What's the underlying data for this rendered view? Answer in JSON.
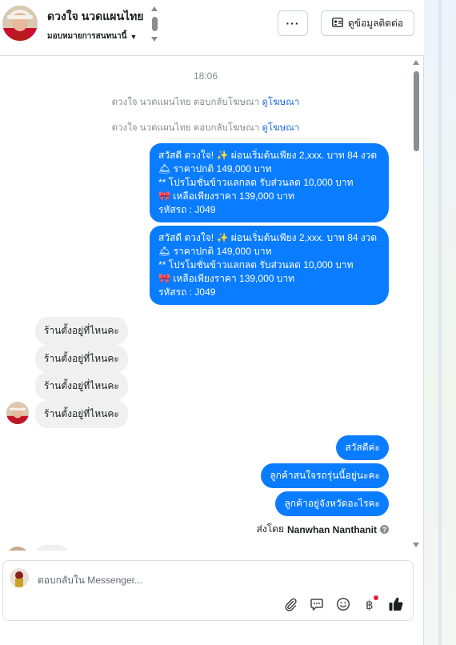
{
  "header": {
    "contact_name": "ดวงใจ นวดแผนไทย",
    "assign_label": "มอบหมายการสนทนานี้",
    "more_label": "···",
    "contact_info_label": "ดูข้อมูลติดต่อ"
  },
  "thread": {
    "time": "18:06",
    "system_messages": [
      {
        "text": "ดวงใจ นวดแผนไทย ตอบกลับโฆษณา",
        "link": "ดูโฆษณา"
      },
      {
        "text": "ดวงใจ นวดแผนไทย ตอบกลับโฆษณา",
        "link": "ดูโฆษณา"
      }
    ],
    "promo_messages": [
      [
        "สวัสดี ดวงใจ! ✨  ผ่อนเริ่มต้นเพียง 2,xxx. บาท 84 งวด",
        "🛎 ราคาปกติ 149,000 บาท",
        "** โปรโมชั่นข้าวแลกลด รับส่วนลด 10,000 บาท",
        "🎀  เหลือเพียงราคา 139,000 บาท",
        " รหัสรถ : J049"
      ],
      [
        "สวัสดี ดวงใจ! ✨  ผ่อนเริ่มต้นเพียง 2,xxx. บาท 84 งวด",
        "🛎 ราคาปกติ 149,000 บาท",
        "** โปรโมชั่นข้าวแลกลด รับส่วนลด 10,000 บาท",
        "🎀  เหลือเพียงราคา 139,000 บาท",
        " รหัสรถ : J049"
      ]
    ],
    "incoming": [
      "ร้านตั้งอยู่ที่ไหนคะ",
      "ร้านตั้งอยู่ที่ไหนคะ",
      "ร้านตั้งอยู่ที่ไหนคะ",
      "ร้านตั้งอยู่ที่ไหนคะ"
    ],
    "outgoing_short": [
      "สวัสดีค่ะ",
      "ลูกค้าสนใจรถรุ่นนี้อยู่นะคะ",
      "ลูกค้าอยู่จังหวัดอะไรคะ"
    ],
    "sent_by_prefix": "ส่งโดย",
    "sent_by_name": "Nanwhan Nanthanit"
  },
  "composer": {
    "placeholder": "ตอบกลับใน Messenger..."
  },
  "colors": {
    "outgoing_bubble": "#0a7cff",
    "incoming_bubble": "#f0f0f0",
    "link": "#216fdb",
    "notification_dot": "#e41e3f"
  },
  "icons": [
    "attach-icon",
    "saved-reply-icon",
    "emoji-icon",
    "currency-icon",
    "like-icon"
  ]
}
